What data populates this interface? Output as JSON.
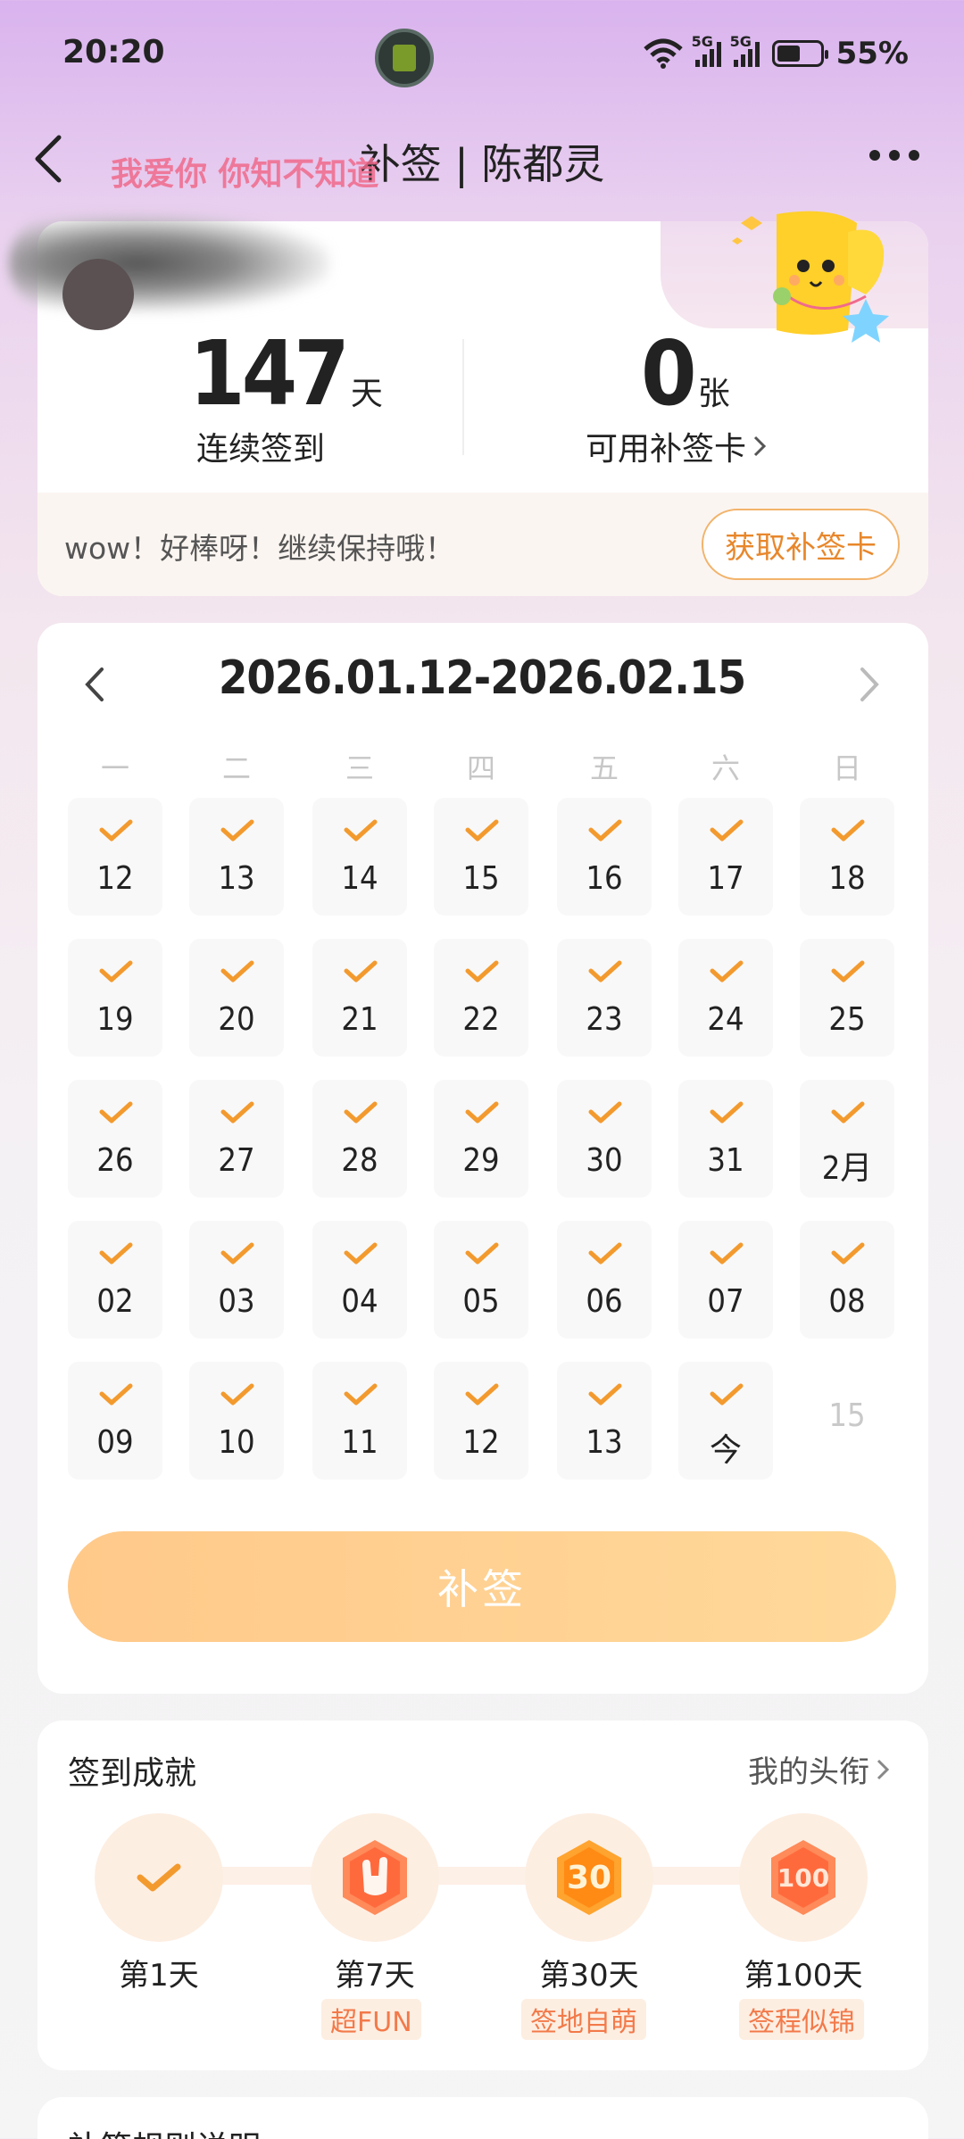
{
  "status_bar": {
    "time": "20:20",
    "network_a": "5G",
    "network_b": "5G",
    "battery": "55%",
    "battery_level": 0.55
  },
  "header": {
    "title": "补签 | 陈都灵",
    "overlay_text": "我爱你 你知不知道"
  },
  "stats": {
    "streak_value": "147",
    "streak_unit": "天",
    "streak_label": "连续签到",
    "cards_value": "0",
    "cards_unit": "张",
    "cards_label": "可用补签卡",
    "encourage_text": "wow！好棒呀！继续保持哦！",
    "get_card_button": "获取补签卡"
  },
  "calendar": {
    "range": "2026.01.12-2026.02.15",
    "weekdays": [
      "一",
      "二",
      "三",
      "四",
      "五",
      "六",
      "日"
    ],
    "weeks": [
      [
        "12",
        "13",
        "14",
        "15",
        "16",
        "17",
        "18"
      ],
      [
        "19",
        "20",
        "21",
        "22",
        "23",
        "24",
        "25"
      ],
      [
        "26",
        "27",
        "28",
        "29",
        "30",
        "31",
        "2月"
      ],
      [
        "02",
        "03",
        "04",
        "05",
        "06",
        "07",
        "08"
      ],
      [
        "09",
        "10",
        "11",
        "12",
        "13",
        "今",
        "15"
      ]
    ],
    "makeup_button": "补签"
  },
  "achievements": {
    "title": "签到成就",
    "link": "我的头衔",
    "items": [
      {
        "label": "第1天",
        "badge": ""
      },
      {
        "label": "第7天",
        "badge": "超FUN"
      },
      {
        "label": "第30天",
        "badge": "签地自萌"
      },
      {
        "label": "第100天",
        "badge": "签程似锦"
      }
    ]
  },
  "rules": {
    "title": "补签规则说明"
  },
  "colors": {
    "accent": "#f39a2e",
    "badge_text": "#f27a4a",
    "button_gradient_start": "#ffc98a"
  }
}
